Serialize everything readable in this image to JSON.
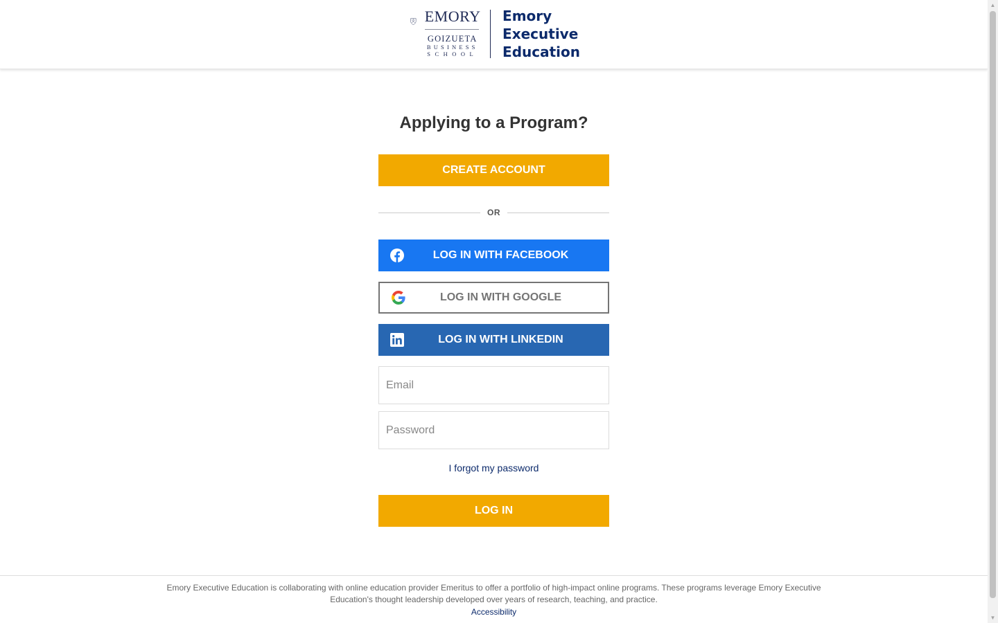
{
  "header": {
    "logo": {
      "emory": "EMORY",
      "goizueta": "GOIZUETA",
      "business": "BUSINESS",
      "school": "SCHOOL",
      "right_line1": "Emory",
      "right_line2": "Executive",
      "right_line3": "Education"
    }
  },
  "main": {
    "title": "Applying to a Program?",
    "create_account": "CREATE ACCOUNT",
    "or_text": "OR",
    "social": {
      "facebook": "LOG IN WITH FACEBOOK",
      "google": "LOG IN WITH GOOGLE",
      "linkedin": "LOG IN WITH LINKEDIN"
    },
    "email_placeholder": "Email",
    "password_placeholder": "Password",
    "forgot": "I forgot my password",
    "login": "LOG IN"
  },
  "footer": {
    "text": "Emory Executive Education is collaborating with online education provider Emeritus to offer a portfolio of high-impact online programs. These programs leverage Emory Executive Education's thought leadership developed over years of research, teaching, and practice.",
    "accessibility": "Accessibility"
  },
  "colors": {
    "gold": "#f2a900",
    "facebook": "#1877f2",
    "linkedin": "#2867b2",
    "navy": "#0c2a6b"
  },
  "icons": [
    "facebook-icon",
    "google-icon",
    "linkedin-icon",
    "emory-shield-icon"
  ]
}
